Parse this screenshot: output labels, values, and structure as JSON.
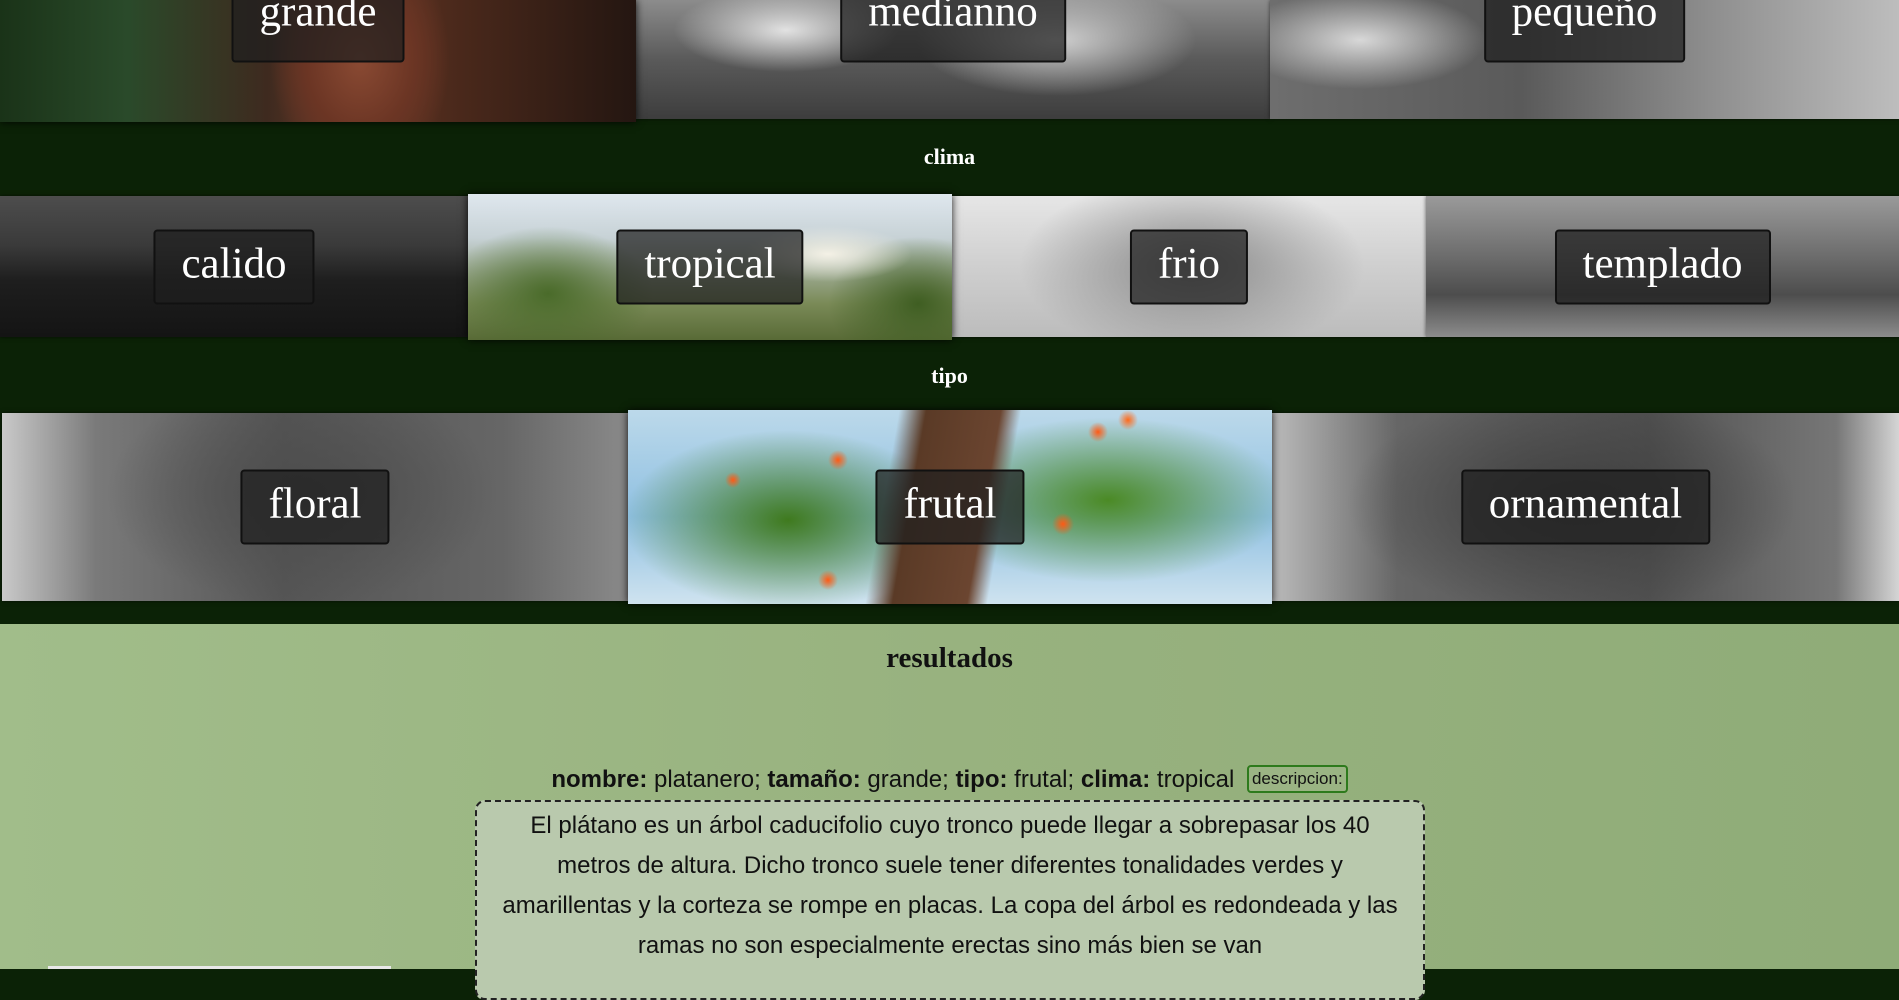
{
  "sections": {
    "clima_heading": "clima",
    "tipo_heading": "tipo"
  },
  "size_options": [
    {
      "label": "grande",
      "selected": true
    },
    {
      "label": "medianno",
      "selected": false
    },
    {
      "label": "pequeño",
      "selected": false
    }
  ],
  "clima_options": [
    {
      "label": "calido",
      "selected": false
    },
    {
      "label": "tropical",
      "selected": true
    },
    {
      "label": "frio",
      "selected": false
    },
    {
      "label": "templado",
      "selected": false
    }
  ],
  "tipo_options": [
    {
      "label": "floral",
      "selected": false
    },
    {
      "label": "frutal",
      "selected": true
    },
    {
      "label": "ornamental",
      "selected": false
    }
  ],
  "results": {
    "title": "resultados",
    "items": [
      {
        "nombre_label": "nombre:",
        "nombre": "platanero",
        "tamano_label": "tamaño:",
        "tamano": "grande",
        "tipo_label": "tipo:",
        "tipo": "frutal",
        "clima_label": "clima:",
        "clima": "tropical",
        "descripcion_button": "descripcion:",
        "descripcion": "El plátano es un árbol caducifolio cuyo tronco puede llegar a sobrepasar los 40 metros de altura. Dicho tronco suele tener diferentes tonalidades verdes y amarillentas y la corteza se rompe en placas. La copa del árbol es redondeada y las ramas no son especialmente erectas sino más bien se van"
      }
    ]
  },
  "colors": {
    "band_background": "#0b2206",
    "results_background": "#98b27f",
    "description_background": "#b9c9ad",
    "button_border": "#2d7a1c"
  }
}
